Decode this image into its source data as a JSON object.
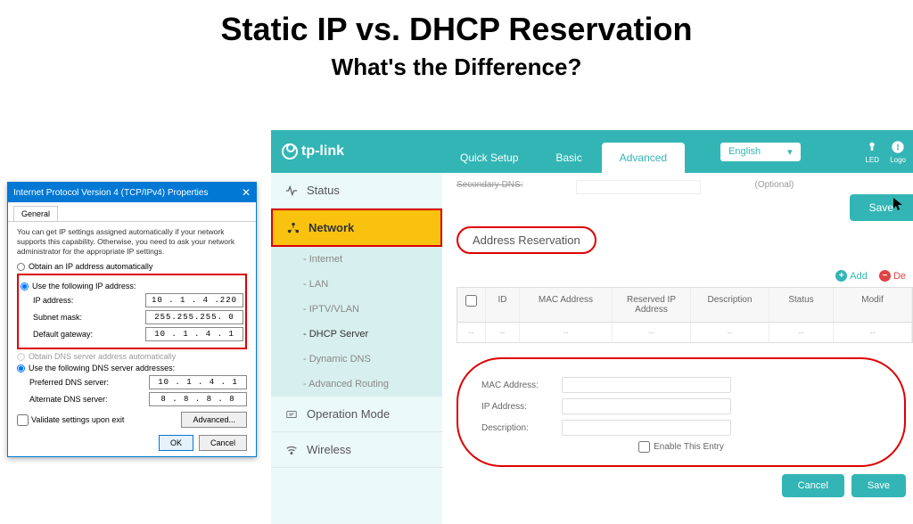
{
  "heading": {
    "title": "Static IP vs. DHCP Reservation",
    "subtitle": "What's the Difference?"
  },
  "windows_dialog": {
    "title": "Internet Protocol Version 4 (TCP/IPv4) Properties",
    "tab": "General",
    "description": "You can get IP settings assigned automatically if your network supports this capability. Otherwise, you need to ask your network administrator for the appropriate IP settings.",
    "radio_auto_ip": "Obtain an IP address automatically",
    "radio_manual_ip": "Use the following IP address:",
    "ip_label": "IP address:",
    "ip_value": "10 . 1 . 4 .220",
    "subnet_label": "Subnet mask:",
    "subnet_value": "255.255.255. 0",
    "gateway_label": "Default gateway:",
    "gateway_value": "10 . 1 . 4 . 1",
    "radio_auto_dns": "Obtain DNS server address automatically",
    "radio_manual_dns": "Use the following DNS server addresses:",
    "pref_dns_label": "Preferred DNS server:",
    "pref_dns_value": "10 . 1 . 4 . 1",
    "alt_dns_label": "Alternate DNS server:",
    "alt_dns_value": "8 . 8 . 8 . 8",
    "validate": "Validate settings upon exit",
    "advanced": "Advanced...",
    "ok": "OK",
    "cancel": "Cancel"
  },
  "router": {
    "brand": "tp-link",
    "tabs": {
      "quick": "Quick Setup",
      "basic": "Basic",
      "advanced": "Advanced"
    },
    "language": "English",
    "header_icons": {
      "led": "LED",
      "logout": "Logo"
    },
    "sidebar": {
      "status": "Status",
      "network": "Network",
      "subs": {
        "internet": "Internet",
        "lan": "LAN",
        "iptv": "IPTV/VLAN",
        "dhcp": "DHCP Server",
        "ddns": "Dynamic DNS",
        "routing": "Advanced Routing"
      },
      "opmode": "Operation Mode",
      "wireless": "Wireless"
    },
    "secondary_dns": "Secondary DNS:",
    "optional": "(Optional)",
    "save": "Save",
    "section": "Address Reservation",
    "add": "Add",
    "delete": "De",
    "table": {
      "id": "ID",
      "mac": "MAC Address",
      "ip": "Reserved IP Address",
      "desc": "Description",
      "status": "Status",
      "modify": "Modif",
      "empty": "--"
    },
    "form": {
      "mac": "MAC Address:",
      "ip": "IP Address:",
      "desc": "Description:",
      "enable": "Enable This Entry",
      "cancel": "Cancel",
      "save": "Save"
    }
  }
}
